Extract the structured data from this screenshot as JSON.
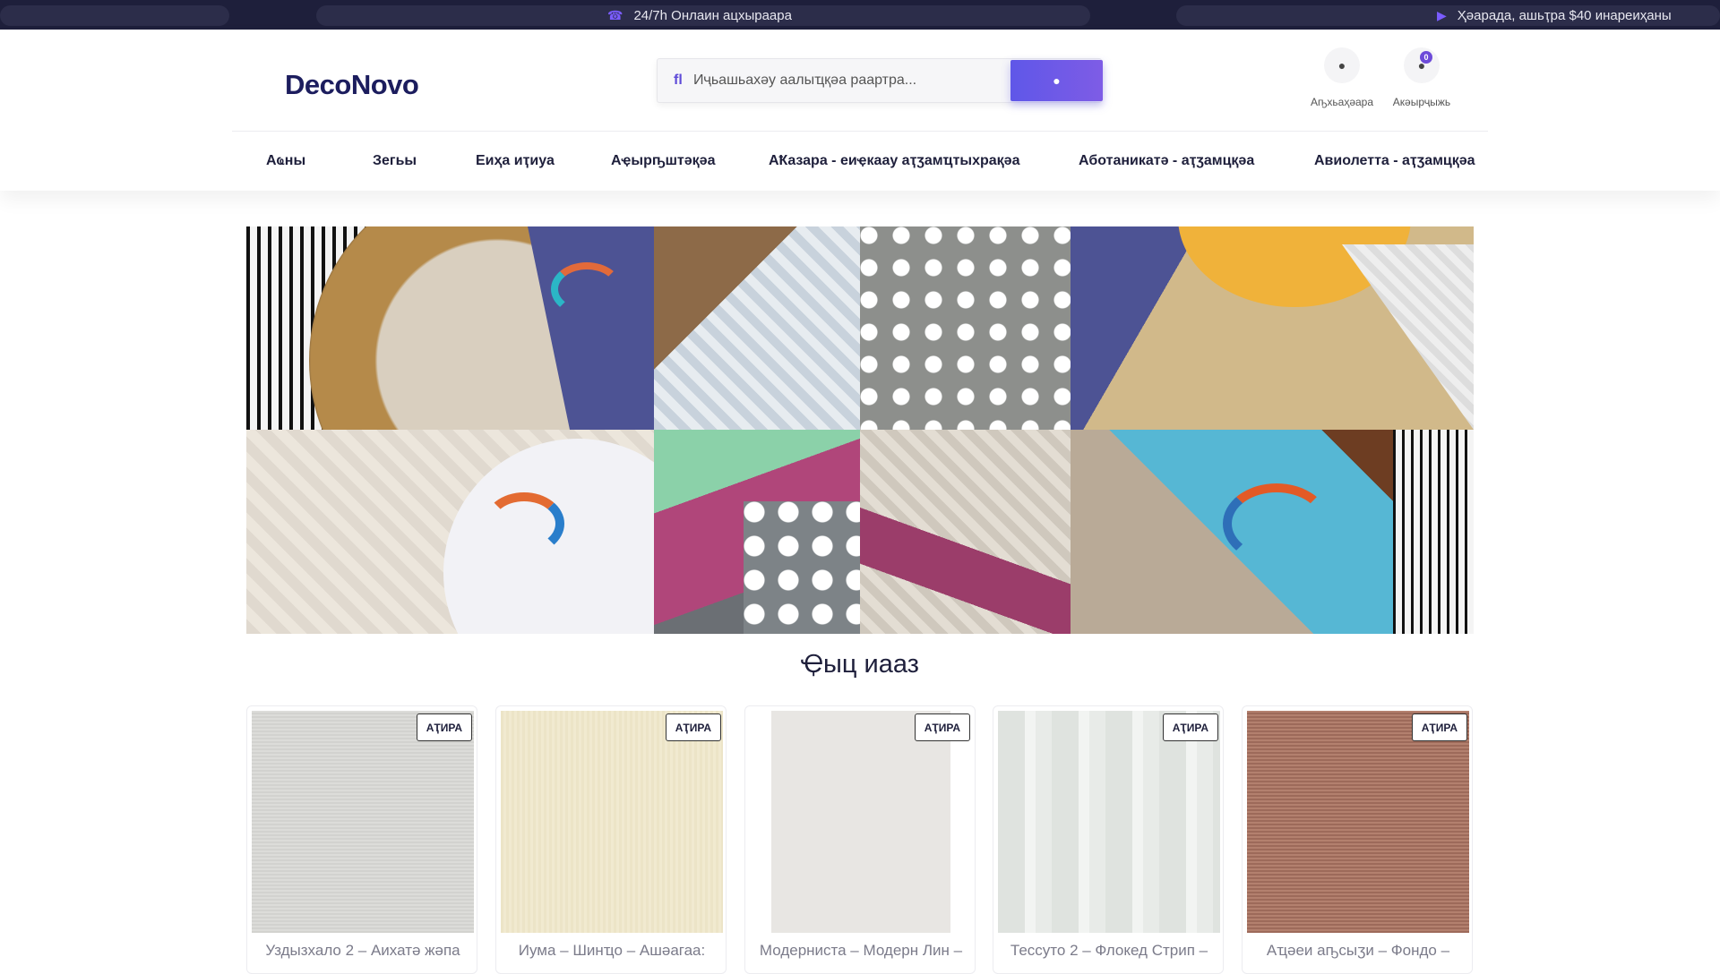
{
  "topbar": {
    "left_message": "24/7h Онлаин ацхыраара",
    "right_message": "Ҳәарада, ашьҭра $40 инареиҳаны",
    "left_icon": "headset-icon",
    "right_icon": "truck-icon"
  },
  "header": {
    "logo_text_a": "Deco",
    "logo_text_b": "Novo",
    "search_placeholder": "Иҷьашьахәу аалыҵқәа раартра...",
    "account_label": "Аҧхьаҳәара",
    "cart_label": "Акәырҷыжь",
    "cart_count": "0"
  },
  "nav": {
    "items": [
      "Аҩны",
      "Зегьы",
      "Еиҳа иҭиуа",
      "Аҿырҧштәқәа",
      "АҞазара - еиҿкаау аҭӡамҵтыхрақәа",
      "Аботаникатә - аҭӡамцқәа",
      "Авиолетта - аҭӡамцқәа"
    ]
  },
  "section": {
    "title": "Ҿыц иааз"
  },
  "products": [
    {
      "tag": "АҬИРА",
      "name": "Уздызхало 2 – Аихатә жәпа"
    },
    {
      "tag": "АҬИРА",
      "name": "Иума – Шинҵо – Ашәагаа:"
    },
    {
      "tag": "АҬИРА",
      "name": "Модерниста – Модерн Лин –"
    },
    {
      "tag": "АҬИРА",
      "name": "Тессуто 2 – Флокед Стрип –"
    },
    {
      "tag": "АҬИРА",
      "name": "Аҵәеи аҧсыӡи – Фондо –"
    }
  ],
  "colors": {
    "topbar_bg": "#1e1f3b",
    "accent": "#6d4bd9",
    "nav_text": "#1e1f3b"
  }
}
